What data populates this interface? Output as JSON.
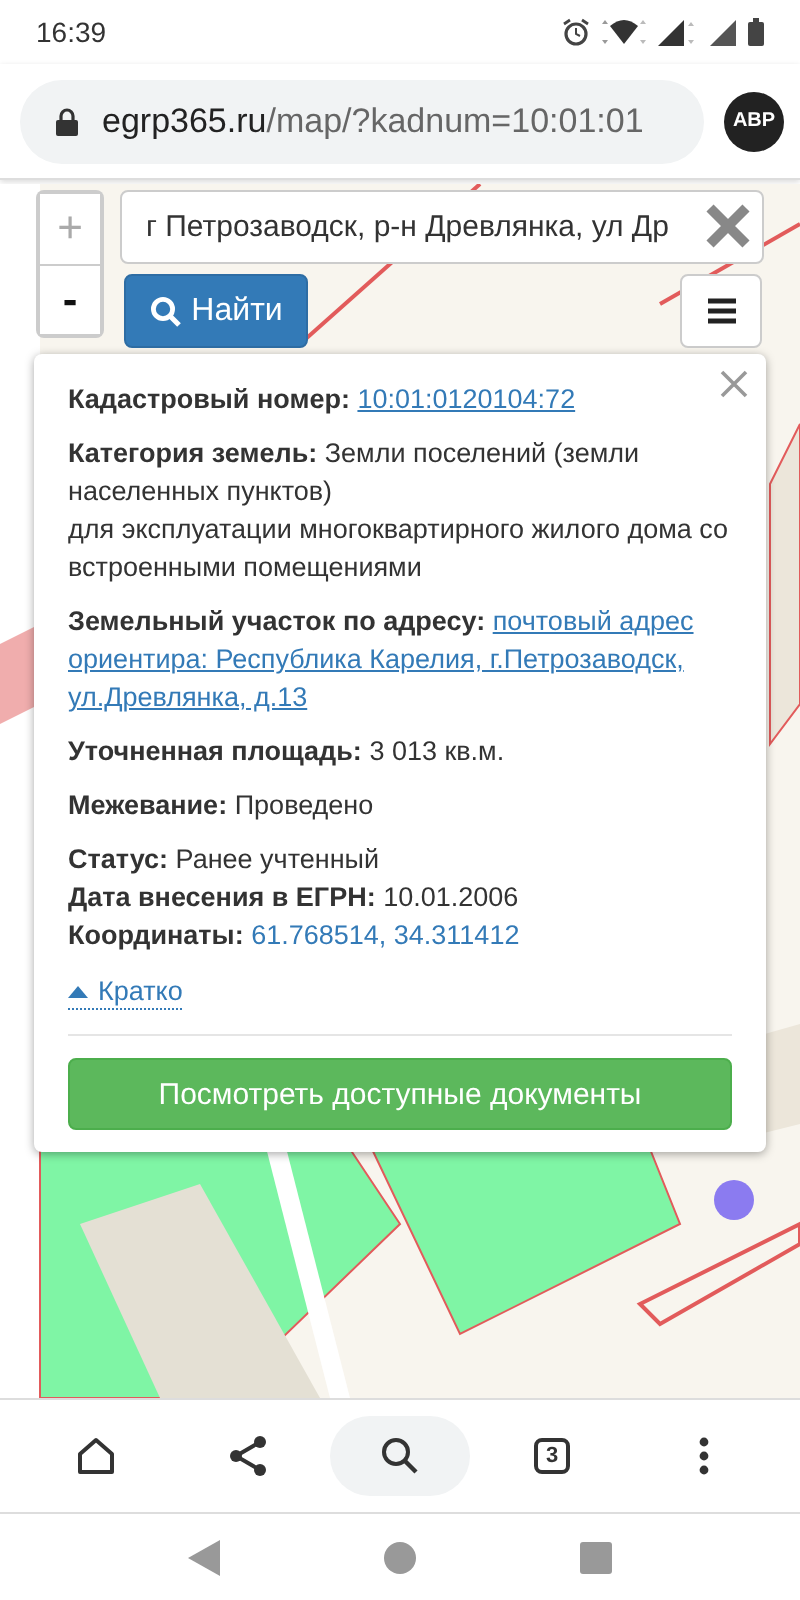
{
  "status_bar": {
    "time": "16:39"
  },
  "browser": {
    "url_domain": "egrp365.ru",
    "url_path": "/map/?kadnum=10:01:01",
    "extension_badge": "ABP"
  },
  "map_controls": {
    "zoom_in": "+",
    "zoom_out": "-",
    "search": {
      "value": "г Петрозаводск, р-н Древлянка, ул Др"
    },
    "find_button": "Найти"
  },
  "popup": {
    "groups": [
      [
        {
          "label": "Кадастровый номер:",
          "value": "10:01:0120104:72",
          "kind": "link"
        }
      ],
      [
        {
          "label": "Категория земель:",
          "value": "Земли поселений (земли населенных пунктов)",
          "kind": "text",
          "note": "для эксплуатации многоквартирного жилого дома со встроенными помещениями"
        }
      ],
      [
        {
          "label": "Земельный участок по адресу:",
          "value": "почтовый адрес ориентира: Республика Карелия, г.Петрозаводск, ул.Древлянка, д.13",
          "kind": "link"
        }
      ],
      [
        {
          "label": "Уточненная площадь:",
          "value": "3 013 кв.м.",
          "kind": "text"
        }
      ],
      [
        {
          "label": "Межевание:",
          "value": "Проведено",
          "kind": "text"
        }
      ],
      [
        {
          "label": "Статус:",
          "value": "Ранее учтенный",
          "kind": "text"
        },
        {
          "label": "Дата внесения в ЕГРН:",
          "value": "10.01.2006",
          "kind": "text"
        },
        {
          "label": "Координаты:",
          "value": "61.768514, 34.311412",
          "kind": "coords"
        }
      ]
    ],
    "toggle": {
      "label": "Кратко",
      "expanded": true
    },
    "documents_button": "Посмотреть доступные документы"
  },
  "bottom_toolbar": {
    "tab_count": "3",
    "search_selected": true
  }
}
